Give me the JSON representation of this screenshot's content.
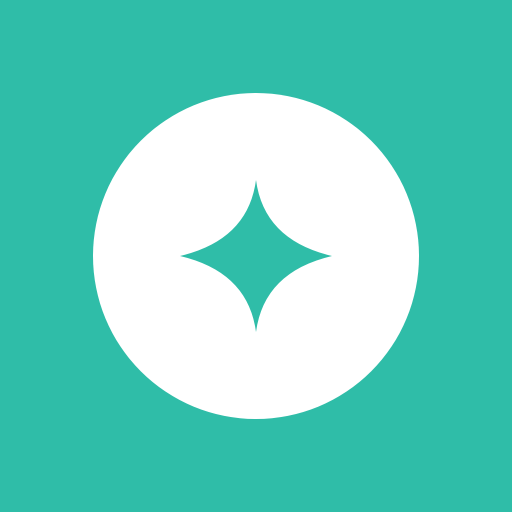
{
  "app_icon": {
    "icon": "sparkle-icon",
    "colors": {
      "background": "#2fbda8",
      "circle": "#ffffff",
      "star": "#2fbda8"
    }
  }
}
